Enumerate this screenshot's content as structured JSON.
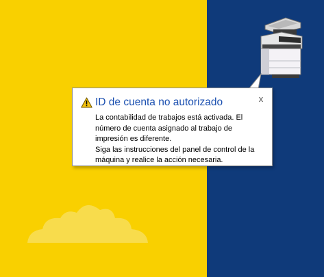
{
  "notification": {
    "title": "ID de cuenta no autorizado",
    "close_glyph": "x",
    "message_lines": [
      "La contabilidad de trabajos está activada. El",
      "número de cuenta asignado al trabajo de",
      "impresión es diferente.",
      "Siga las instrucciones del panel de control de la",
      "máquina y realice la acción necesaria."
    ],
    "icon": "warning-icon"
  },
  "colors": {
    "background_left": "#f9d000",
    "background_right": "#0f3a7a",
    "title": "#1a4fb0",
    "warning": "#f4c20d"
  },
  "printer_icon": "printer-icon",
  "cloud_icon": "cloud-icon"
}
